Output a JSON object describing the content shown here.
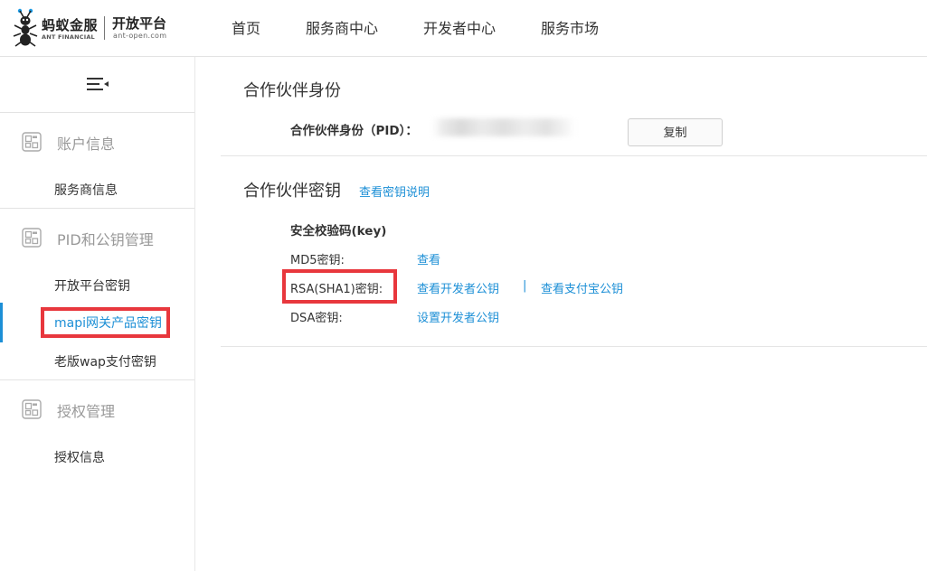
{
  "header": {
    "logo_cn": "蚂蚁金服",
    "logo_en": "ANT FINANCIAL",
    "platform": "开放平台",
    "platform_url": "ant-open.com",
    "nav": [
      "首页",
      "服务商中心",
      "开发者中心",
      "服务市场"
    ]
  },
  "sidebar": {
    "groups": [
      {
        "label": "账户信息",
        "items": [
          "服务商信息"
        ]
      },
      {
        "label": "PID和公钥管理",
        "items": [
          "开放平台密钥",
          "mapi网关产品密钥",
          "老版wap支付密钥"
        ]
      },
      {
        "label": "授权管理",
        "items": [
          "授权信息"
        ]
      }
    ],
    "active_item": "mapi网关产品密钥"
  },
  "partner_id": {
    "title": "合作伙伴身份",
    "pid_label": "合作伙伴身份（PID）：",
    "copy_label": "复制"
  },
  "partner_key": {
    "title": "合作伙伴密钥",
    "help_link": "查看密钥说明",
    "key_heading": "安全校验码(key)",
    "rows": [
      {
        "label": "MD5密钥:",
        "links": [
          "查看"
        ]
      },
      {
        "label": "RSA(SHA1)密钥:",
        "links": [
          "查看开发者公钥",
          "查看支付宝公钥"
        ],
        "separator": "|"
      },
      {
        "label": "DSA密钥:",
        "links": [
          "设置开发者公钥"
        ]
      }
    ]
  },
  "colors": {
    "link": "#1c8fd6",
    "highlight": "#e8373d",
    "muted": "#999999"
  }
}
